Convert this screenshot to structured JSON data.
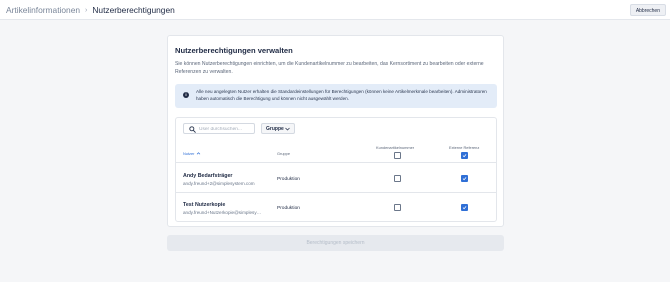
{
  "header": {
    "breadcrumb_parent": "Artikelinformationen",
    "breadcrumb_separator": "›",
    "breadcrumb_current": "Nutzerberechtigungen",
    "cancel_label": "Abbrechen"
  },
  "card": {
    "title": "Nutzerberechtigungen verwalten",
    "description": "Sie können Nutzerberechtigungen einrichten, um die Kundenartikelnummer zu bearbeiten, das Kernsortiment zu bearbeiten oder externe Referenzen zu verwalten.",
    "info_icon": "i",
    "info_text": "Alle neu angelegten Nutzer erhalten die Standardeinstellungen für Berechtigungen (können keine Artikelmerkmale bearbeiten). Administratoren haben automatisch die Berechtigung und können nicht ausgewählt werden."
  },
  "table": {
    "search_placeholder": "User durchsuchen...",
    "group_filter_label": "Gruppe",
    "columns": {
      "user": "Nutzer",
      "group": "Gruppe",
      "customer_article_number": "Kundenartikelnummer",
      "external_reference": "Externe Referenz"
    },
    "header_checkboxes": {
      "customer_article_number": false,
      "external_reference": true
    },
    "rows": [
      {
        "name": "Andy Bedarfsträger",
        "email": "andy.freund+2@simplesystem.com",
        "group": "Produktion",
        "customer_article_number": false,
        "external_reference": true
      },
      {
        "name": "Test Nutzerkopie",
        "email": "andy.freund+Nutzerkopie@simplesystem.com",
        "group": "Produktion",
        "customer_article_number": false,
        "external_reference": true
      }
    ]
  },
  "save_label": "Berechtigungen speichern",
  "colors": {
    "accent": "#2f6fd6",
    "info_bg": "#e3ecf8",
    "text_primary": "#1f2a44"
  }
}
